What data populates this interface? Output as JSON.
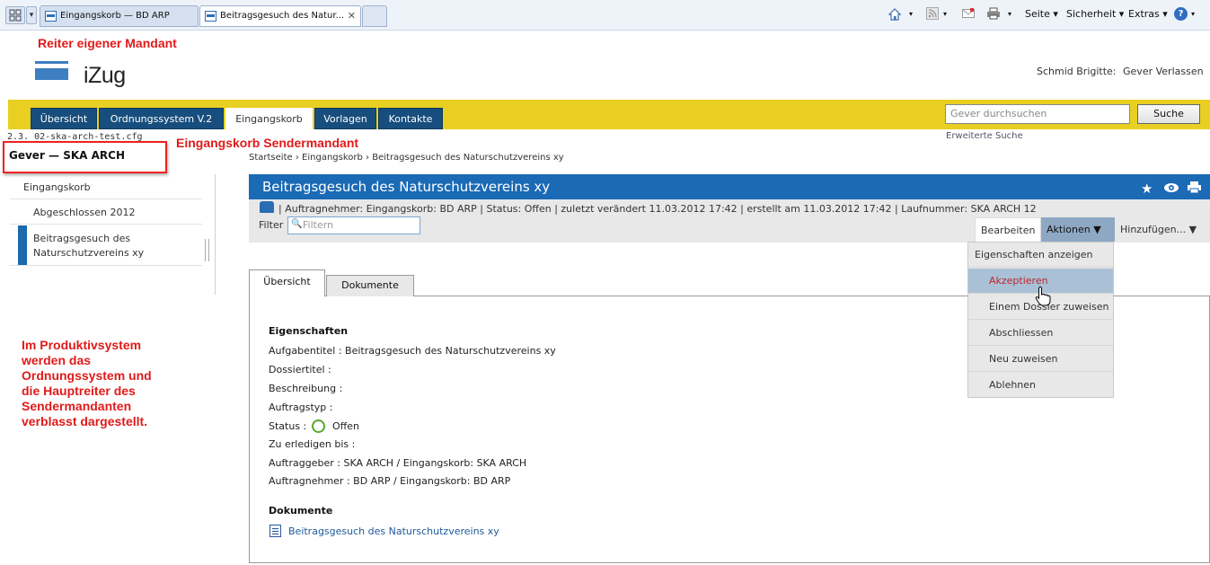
{
  "browser": {
    "tabs": [
      {
        "label": "Eingangskorb — BD ARP"
      },
      {
        "label": "Beitragsgesuch des Natur..."
      }
    ],
    "menu": {
      "page": "Seite",
      "security": "Sicherheit",
      "extras": "Extras",
      "help": "?"
    }
  },
  "annotations": {
    "own_mandant": "Reiter eigener Mandant",
    "sender_inbox": "Eingangskorb Sendermandant",
    "production_note": [
      "Im Produktivsystem",
      "werden das",
      "Ordnungssystem und",
      "die Hauptreiter des",
      "Sendermandanten",
      "verblasst dargestellt."
    ]
  },
  "logo": {
    "text": "iZug"
  },
  "user": {
    "name": "Schmid Brigitte:",
    "logout": "Gever Verlassen"
  },
  "nav": {
    "tabs": [
      {
        "label": "Übersicht"
      },
      {
        "label": "Ordnungssystem V.2"
      },
      {
        "label": "Eingangskorb",
        "active": true
      },
      {
        "label": "Vorlagen"
      },
      {
        "label": "Kontakte"
      }
    ],
    "search_placeholder": "Gever durchsuchen",
    "search_button": "Suche",
    "advanced_search": "Erweiterte Suche"
  },
  "config": "2.3. 02-ska-arch-test.cfg",
  "mandant_title": "Gever — SKA ARCH",
  "sidebar": {
    "items": [
      {
        "label": "Eingangskorb"
      },
      {
        "label": "Abgeschlossen 2012"
      },
      {
        "label": "Beitragsgesuch des Naturschutzvereins xy",
        "line1": "Beitragsgesuch des",
        "line2": "Naturschutzvereins xy",
        "active": true
      }
    ]
  },
  "breadcrumb": {
    "home": "Startseite",
    "sep": "›",
    "inbox": "Eingangskorb",
    "current": "Beitragsgesuch des Naturschutzvereins xy"
  },
  "content": {
    "title": "Beitragsgesuch des Naturschutzvereins xy",
    "meta": "| Auftragnehmer: Eingangskorb: BD ARP | Status:  Offen | zuletzt verändert 11.03.2012 17:42 | erstellt am 11.03.2012 17:42 | Laufnummer: SKA ARCH 12",
    "filter_label": "Filter",
    "filter_placeholder": "Filtern",
    "actions": {
      "edit": "Bearbeiten",
      "actions": "Aktionen ▼",
      "add": "Hinzufügen... ▼"
    },
    "dropdown": [
      {
        "label": "Eigenschaften anzeigen"
      },
      {
        "label": "Akzeptieren",
        "highlighted": true
      },
      {
        "label": "Einem Dossier zuweisen"
      },
      {
        "label": "Abschliessen"
      },
      {
        "label": "Neu zuweisen"
      },
      {
        "label": "Ablehnen"
      }
    ],
    "tabs": [
      {
        "label": "Übersicht",
        "active": true
      },
      {
        "label": "Dokumente"
      }
    ],
    "properties_title": "Eigenschaften",
    "properties": [
      "Aufgabentitel : Beitragsgesuch des Naturschutzvereins xy",
      "Dossiertitel :",
      "Beschreibung :",
      "Auftragstyp :",
      "Status :",
      "Zu erledigen bis :",
      "Auftraggeber : SKA ARCH / Eingangskorb: SKA ARCH",
      "Auftragnehmer : BD ARP / Eingangskorb: BD ARP"
    ],
    "status_value": "Offen",
    "documents_title": "Dokumente",
    "document_link": "Beitragsgesuch des Naturschutzvereins xy"
  },
  "colors": {
    "nav_yellow": "#e8cf21",
    "nav_blue": "#174e7d",
    "header_blue": "#1a6ab5",
    "annotation_red": "#e11a1a",
    "status_green": "#59a82b"
  }
}
